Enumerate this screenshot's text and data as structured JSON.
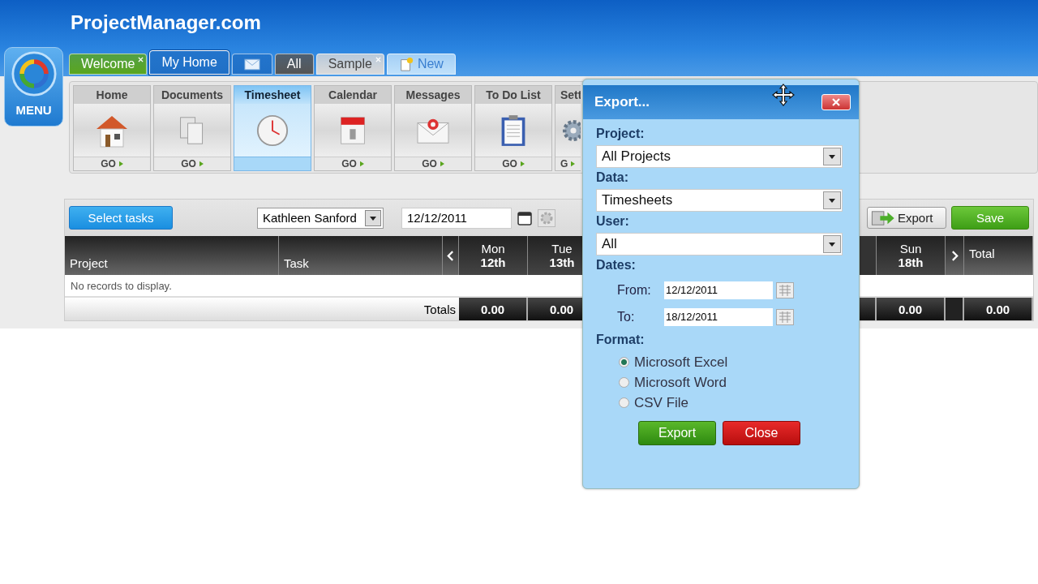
{
  "site_title": "ProjectManager.com",
  "menu": {
    "label": "MENU"
  },
  "tabs": [
    {
      "kind": "text",
      "label": "Welcome",
      "color": "#5aa51e",
      "selected": false,
      "closable": true
    },
    {
      "kind": "text",
      "label": "My Home",
      "color": "#1f6fc6",
      "selected": true,
      "closable": false
    },
    {
      "kind": "mail",
      "color": "#1f6fc6",
      "selected": false,
      "closable": false
    },
    {
      "kind": "text",
      "label": "All",
      "color": "#555555",
      "selected": false,
      "closable": false
    },
    {
      "kind": "text",
      "label": "Sample",
      "color": "#d9d9d9",
      "selected": false,
      "closable": true
    },
    {
      "kind": "new",
      "label": "New",
      "color": "#bfe0fa",
      "selected": false,
      "closable": false
    }
  ],
  "modules": [
    {
      "label": "Home",
      "kind": "house",
      "selected": false,
      "go": "GO"
    },
    {
      "label": "Documents",
      "kind": "documents",
      "selected": false,
      "go": "GO"
    },
    {
      "label": "Timesheet",
      "kind": "clock",
      "selected": true
    },
    {
      "label": "Calendar",
      "kind": "calendar",
      "selected": false,
      "go": "GO"
    },
    {
      "label": "Messages",
      "kind": "envelope",
      "selected": false,
      "go": "GO"
    },
    {
      "label": "To Do List",
      "kind": "clipboard",
      "selected": false,
      "go": "GO"
    },
    {
      "label": "Sett",
      "kind": "gear",
      "selected": false,
      "go": "G"
    }
  ],
  "toolbar": {
    "select_tasks": "Select tasks",
    "user": "Kathleen Sanford",
    "date": "12/12/2011",
    "export": "Export",
    "save": "Save"
  },
  "table": {
    "columns": [
      "Project",
      "Task"
    ],
    "days": [
      {
        "day": "Mon",
        "date": "12th",
        "total": "0.00"
      },
      {
        "day": "Tue",
        "date": "13th",
        "total": "0.00"
      }
    ],
    "last_day": {
      "day": "Sun",
      "date": "18th",
      "total": "0.00"
    },
    "total_label": "Total",
    "grand_total": "0.00",
    "empty_message": "No records to display.",
    "totals_label": "Totals"
  },
  "dialog": {
    "title": "Export...",
    "selects": [
      {
        "label": "Project:",
        "value": "All Projects"
      },
      {
        "label": "Data:",
        "value": "Timesheets"
      },
      {
        "label": "User:",
        "value": "All"
      }
    ],
    "dates_label": "Dates:",
    "dates": [
      {
        "label": "From:",
        "value": "12/12/2011"
      },
      {
        "label": "To:",
        "value": "18/12/2011"
      }
    ],
    "format_label": "Format:",
    "formats": [
      {
        "label": "Microsoft Excel",
        "selected": true
      },
      {
        "label": "Microsoft Word",
        "selected": false
      },
      {
        "label": "CSV File",
        "selected": false
      }
    ],
    "export_button": "Export",
    "close_button": "Close"
  }
}
